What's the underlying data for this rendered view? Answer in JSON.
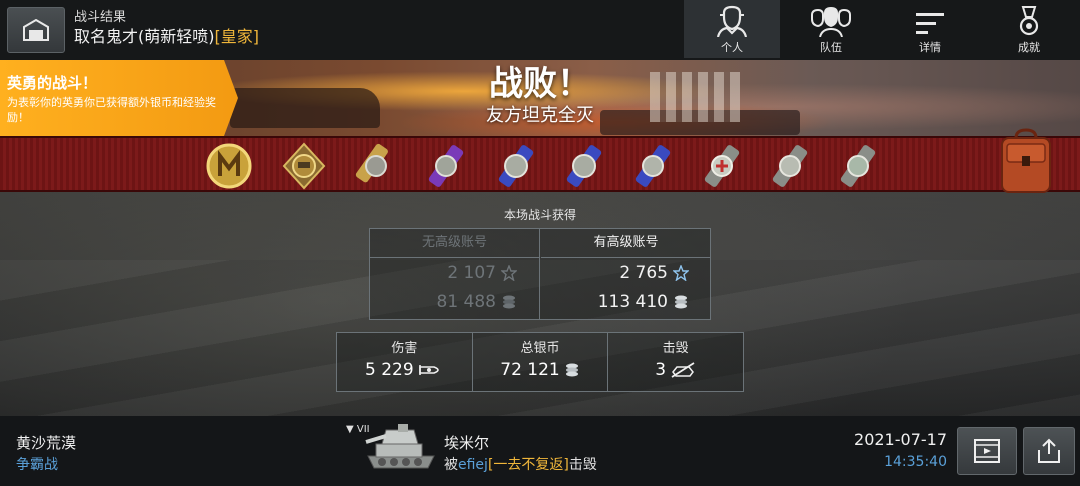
{
  "header": {
    "subtitle": "战斗结果",
    "player_name": "取名鬼才(萌新轻喷)",
    "clan_tag": "[皇家]",
    "garage_icon": "garage-icon"
  },
  "tabs": [
    {
      "label": "个人",
      "icon": "personal-icon",
      "active": true
    },
    {
      "label": "队伍",
      "icon": "team-icon",
      "active": false
    },
    {
      "label": "详情",
      "icon": "details-icon",
      "active": false
    },
    {
      "label": "成就",
      "icon": "achievements-icon",
      "active": false
    }
  ],
  "banner": {
    "brave_title": "英勇的战斗！",
    "brave_desc": "为表彰你的英勇你已获得额外银币和经验奖励！",
    "result_title": "战败！",
    "result_subtitle": "友方坦克全灭"
  },
  "earnings": {
    "title": "本场战斗获得",
    "no_premium": {
      "label": "无高级账号",
      "xp": "2 107",
      "credits": "81 488"
    },
    "premium": {
      "label": "有高级账号",
      "xp": "2 765",
      "credits": "113 410"
    }
  },
  "stats": {
    "damage": {
      "label": "伤害",
      "value": "5 229"
    },
    "credits": {
      "label": "总银币",
      "value": "72 121"
    },
    "kills": {
      "label": "击毁",
      "value": "3"
    }
  },
  "footer": {
    "map": "黄沙荒漠",
    "mode": "争霸战",
    "tier": "▼ VII",
    "tank": "埃米尔",
    "killed_prefix": "被",
    "killer": "efiej",
    "killer_clan": "[一去不复返]",
    "killed_suffix": "击毁",
    "date": "2021-07-17",
    "time": "14:35:40"
  },
  "colors": {
    "accent_orange": "#f39a12",
    "link_blue": "#5aa0d8",
    "clan_gold": "#f0b63a",
    "medal_red": "#7c1a1a"
  }
}
